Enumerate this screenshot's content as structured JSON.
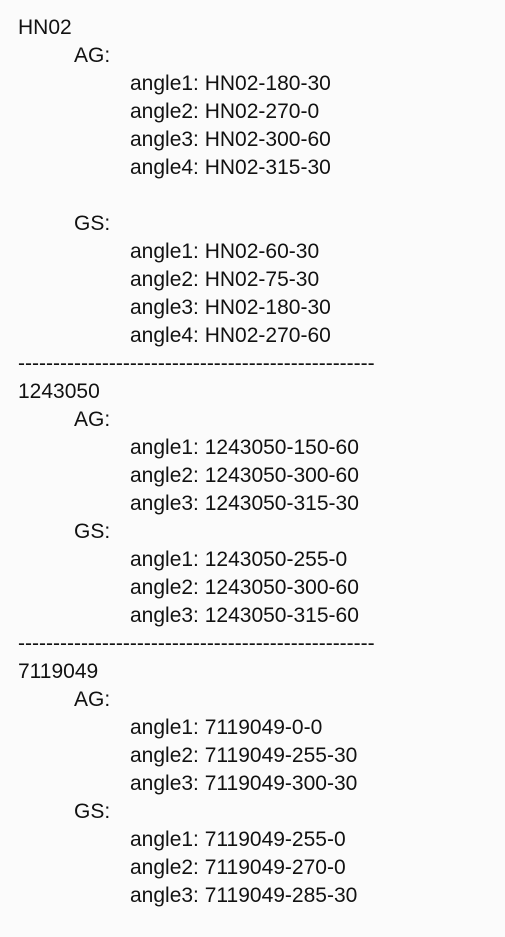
{
  "separator": "---------------------------------------------------",
  "sections": [
    {
      "id": "HN02",
      "groups": [
        {
          "label": "AG:",
          "items": [
            "angle1: HN02-180-30",
            "angle2: HN02-270-0",
            "angle3: HN02-300-60",
            "angle4: HN02-315-30"
          ]
        },
        {
          "label": "GS:",
          "items": [
            "angle1: HN02-60-30",
            "angle2: HN02-75-30",
            "angle3: HN02-180-30",
            "angle4: HN02-270-60"
          ]
        }
      ]
    },
    {
      "id": "1243050",
      "groups": [
        {
          "label": "AG:",
          "items": [
            "angle1: 1243050-150-60",
            "angle2: 1243050-300-60",
            "angle3: 1243050-315-30"
          ]
        },
        {
          "label": "GS:",
          "items": [
            "angle1: 1243050-255-0",
            "angle2: 1243050-300-60",
            "angle3: 1243050-315-60"
          ]
        }
      ]
    },
    {
      "id": "7119049",
      "groups": [
        {
          "label": "AG:",
          "items": [
            "angle1: 7119049-0-0",
            "angle2: 7119049-255-30",
            "angle3: 7119049-300-30"
          ]
        },
        {
          "label": "GS:",
          "items": [
            "angle1: 7119049-255-0",
            "angle2: 7119049-270-0",
            "angle3: 7119049-285-30"
          ]
        }
      ]
    }
  ]
}
